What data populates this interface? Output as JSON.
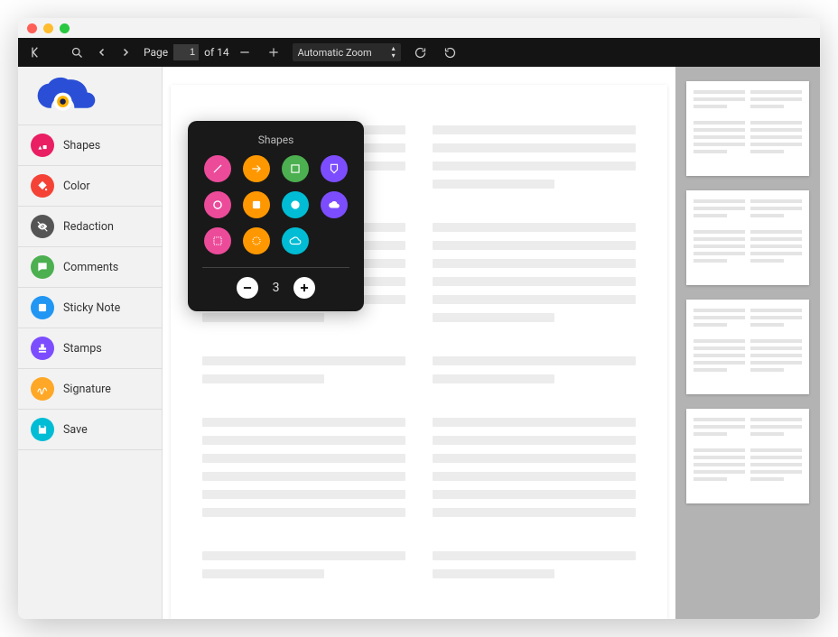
{
  "toolbar": {
    "page_label": "Page",
    "page_current": "1",
    "page_total": "of 14",
    "zoom_select": "Automatic Zoom"
  },
  "sidebar": {
    "items": [
      {
        "label": "Shapes",
        "color": "#e91e63",
        "icon": "shapes"
      },
      {
        "label": "Color",
        "color": "#f44336",
        "icon": "paint"
      },
      {
        "label": "Redaction",
        "color": "#555555",
        "icon": "eye-off"
      },
      {
        "label": "Comments",
        "color": "#4caf50",
        "icon": "chat"
      },
      {
        "label": "Sticky Note",
        "color": "#2196f3",
        "icon": "note"
      },
      {
        "label": "Stamps",
        "color": "#7c4dff",
        "icon": "stamp"
      },
      {
        "label": "Signature",
        "color": "#ffa726",
        "icon": "sign"
      },
      {
        "label": "Save",
        "color": "#00bcd4",
        "icon": "save"
      }
    ]
  },
  "shapes_popup": {
    "title": "Shapes",
    "size_value": "3",
    "colors": {
      "pink": "#ec4b9a",
      "orange": "#ff9800",
      "green": "#4caf50",
      "purple": "#7c4dff",
      "cyan": "#00bcd4"
    },
    "shapes": [
      {
        "name": "line",
        "color": "pink"
      },
      {
        "name": "arrow",
        "color": "orange"
      },
      {
        "name": "rect",
        "color": "green"
      },
      {
        "name": "polygon",
        "color": "purple"
      },
      {
        "name": "ring",
        "color": "pink"
      },
      {
        "name": "rect-filled",
        "color": "orange"
      },
      {
        "name": "circle-fill",
        "color": "cyan"
      },
      {
        "name": "cloud-fill",
        "color": "purple"
      },
      {
        "name": "rect-dotted",
        "color": "pink"
      },
      {
        "name": "circle-dot",
        "color": "orange"
      },
      {
        "name": "cloud",
        "color": "cyan"
      }
    ]
  }
}
